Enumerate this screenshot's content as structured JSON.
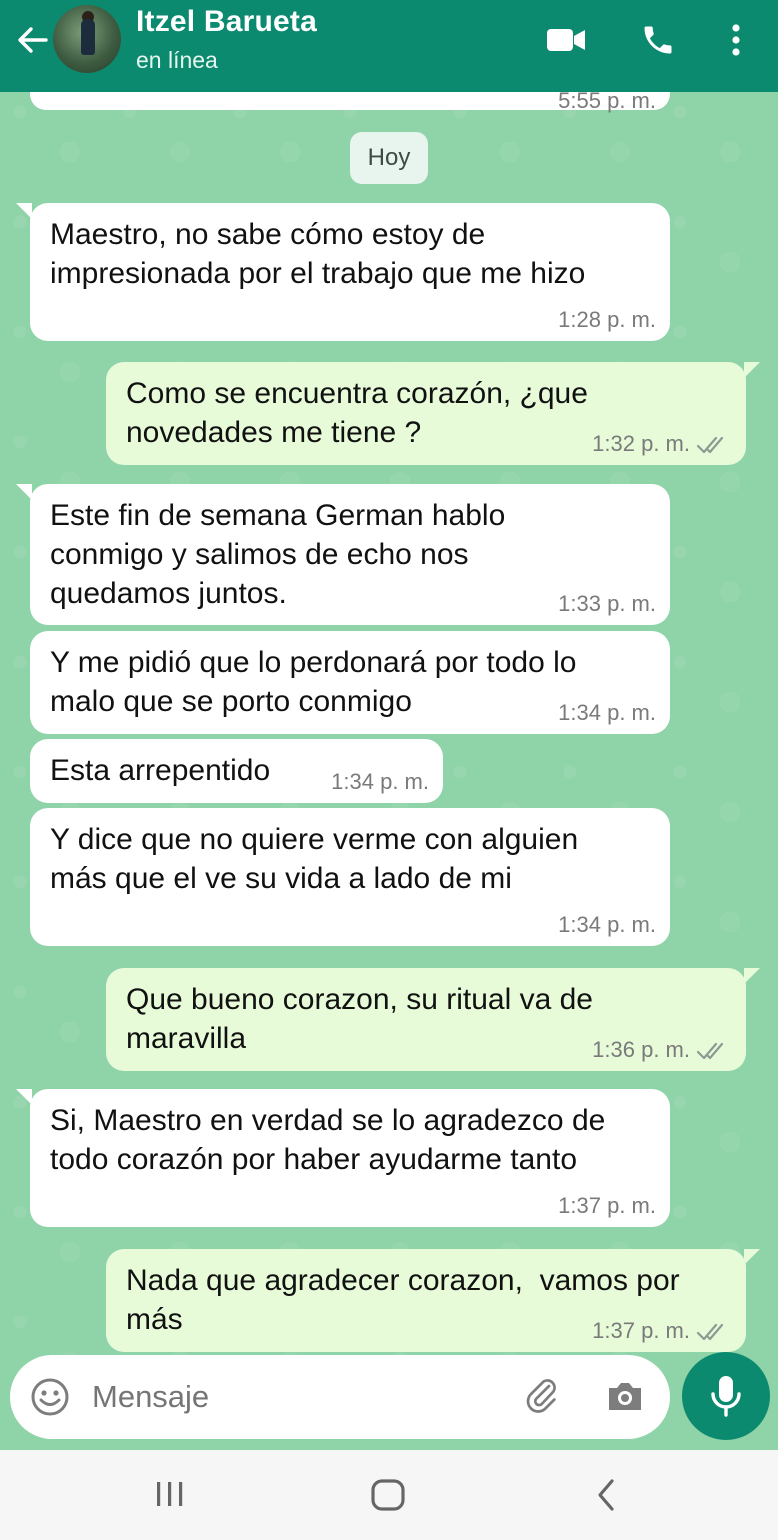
{
  "header": {
    "name": "Itzel Barueta",
    "status": "en línea"
  },
  "chat": {
    "top_fragment_time": "5:55 p. m.",
    "day_label": "Hoy",
    "messages": [
      {
        "dir": "in",
        "text": "Maestro, no sabe cómo estoy de\nimpresionada por el trabajo que me hizo",
        "time": "1:28 p. m."
      },
      {
        "dir": "out",
        "text": "Como se encuentra corazón, ¿que\nnovedades me tiene ?",
        "time": "1:32 p. m."
      },
      {
        "dir": "in",
        "text": "Este fin de semana German hablo\nconmigo y salimos de echo nos\nquedamos juntos.",
        "time": "1:33 p. m."
      },
      {
        "dir": "in",
        "text": "Y me pidió que lo perdonará por todo lo\nmalo que se porto conmigo",
        "time": "1:34 p. m."
      },
      {
        "dir": "in",
        "text": "Esta arrepentido",
        "time": "1:34 p. m."
      },
      {
        "dir": "in",
        "text": "Y dice que no quiere verme con alguien\nmás que el ve su vida a lado de mi",
        "time": "1:34 p. m."
      },
      {
        "dir": "out",
        "text": "Que bueno corazon, su ritual va de\nmaravilla",
        "time": "1:36 p. m."
      },
      {
        "dir": "in",
        "text": "Si, Maestro en verdad se lo agradezco de\ntodo corazón por haber ayudarme tanto",
        "time": "1:37 p. m."
      },
      {
        "dir": "out",
        "text": "Nada que agradecer corazon,  vamos por\nmás",
        "time": "1:37 p. m."
      }
    ]
  },
  "composer": {
    "placeholder": "Mensaje"
  },
  "icons": [
    "back-arrow-icon",
    "video-call-icon",
    "phone-icon",
    "more-vert-icon",
    "emoji-icon",
    "attach-icon",
    "camera-icon",
    "mic-icon",
    "double-check-icon",
    "recent-apps-icon",
    "home-icon",
    "nav-back-icon"
  ],
  "colors": {
    "header": "#0b8a6f",
    "chat_bg": "#8fd3a8",
    "incoming": "#ffffff",
    "outgoing": "#e7fbd9",
    "mic_button": "#0b8a6f"
  }
}
